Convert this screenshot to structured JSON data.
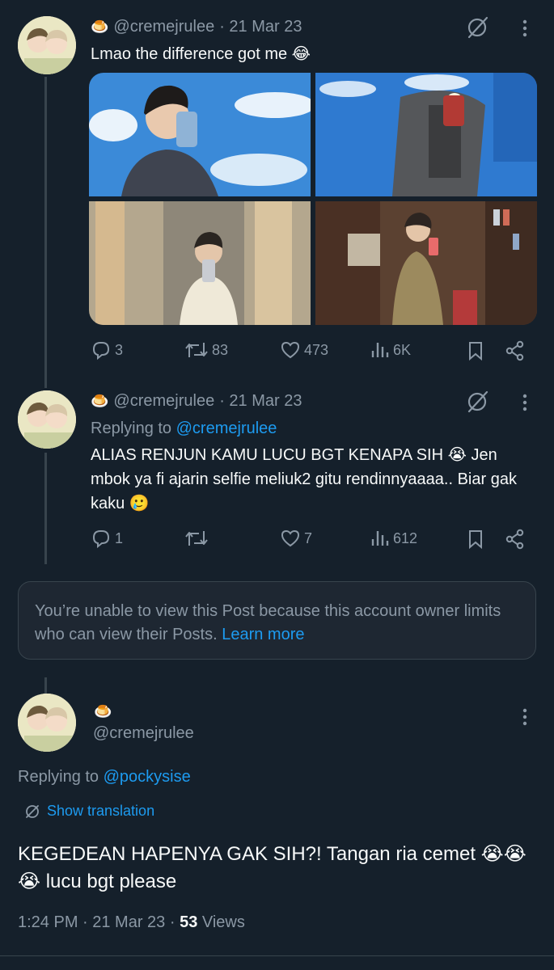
{
  "tweet1": {
    "emoji": "🍮",
    "handle": "@cremejrulee",
    "date": "· 21 Mar 23",
    "text": "Lmao the difference got me 😂",
    "replies": "3",
    "retweets": "83",
    "likes": "473",
    "views": "6K"
  },
  "tweet2": {
    "emoji": "🍮",
    "handle": "@cremejrulee",
    "date": "· 21 Mar 23",
    "replying_label": "Replying to",
    "replying_handle": "@cremejrulee",
    "text": "ALIAS RENJUN KAMU LUCU BGT KENAPA SIH 😭 Jen mbok ya fi ajarin selfie meliuk2 gitu rendinnyaaaa.. Biar gak kaku 🥲",
    "replies": "1",
    "retweets": "",
    "likes": "7",
    "views": "612"
  },
  "notice": {
    "text": "You’re unable to view this Post because this account owner limits who can view their Posts.",
    "link": "Learn more"
  },
  "main": {
    "emoji": "🍮",
    "handle": "@cremejrulee",
    "replying_label": "Replying to",
    "replying_handle": "@pockysise",
    "translate": "Show translation",
    "text": "KEGEDEAN HAPENYA GAK SIH?! Tangan ria cemet 😭😭😭 lucu bgt please",
    "time": "1:24 PM · 21 Mar 23 · ",
    "views_count": "53",
    "views_label": " Views"
  },
  "colors": {
    "background": "#15202b",
    "muted": "#8b98a5",
    "link": "#1d9bf0",
    "border": "#38444d"
  },
  "icons": [
    "reply-icon",
    "retweet-icon",
    "like-icon",
    "views-icon",
    "bookmark-icon",
    "share-icon",
    "grok-icon",
    "more-icon",
    "translate-icon"
  ]
}
